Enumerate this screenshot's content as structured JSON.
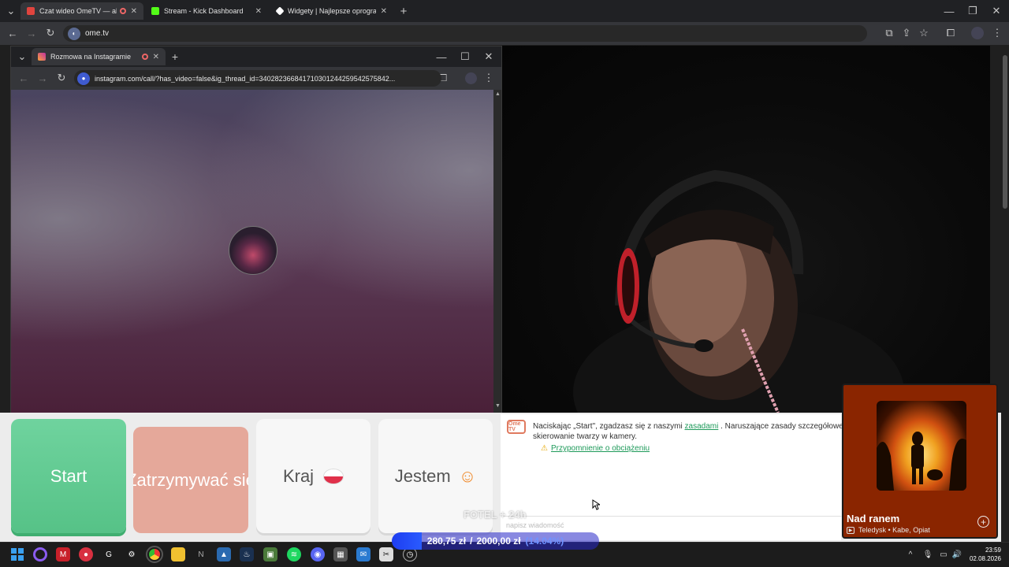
{
  "outer_browser": {
    "tabs": [
      {
        "title": "Czat wideo OmeTV — alter",
        "favicon_color": "#e0443e"
      },
      {
        "title": "Stream - Kick Dashboard",
        "favicon_color": "#53fc18"
      },
      {
        "title": "Widgety | Najlepsze oprogram",
        "favicon_color": "#ffffff"
      }
    ],
    "url": "ome.tv"
  },
  "inner_browser": {
    "tab_title": "Rozmowa na Instagramie",
    "url": "instagram.com/call/?has_video=false&ig_thread_id=340282366841710301244259542575842..."
  },
  "buttons": {
    "start": "Start",
    "stop": "Zatrzymywać się",
    "country": "Kraj",
    "gender": "Jestem"
  },
  "chat": {
    "logo_text": "Ome TV",
    "notice_before": "Naciskając „Start\", zgadzasz się z naszymi",
    "notice_link": "zasadami",
    "notice_after": ". Naruszające zasady szczegółowe skierowanie twarzy w kamery.",
    "reminder_link": "Przypomnienie o obciążeniu",
    "input_placeholder": "napisz wiadomość"
  },
  "music": {
    "title": "Nad ranem",
    "subtitle": "Teledysk • Kabe, Opiat"
  },
  "goal": {
    "label": "FOTEL + 24h",
    "current": "280,75 zł",
    "separator": "/",
    "target": "2000,00 zł",
    "percent": "(14.04%)",
    "fraction": 0.1404
  },
  "taskbar": {
    "time": "23:59",
    "date": "02.08.2026"
  }
}
